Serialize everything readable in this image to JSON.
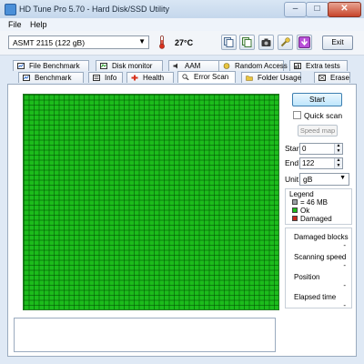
{
  "window": {
    "title": "HD Tune Pro 5.70 - Hard Disk/SSD Utility",
    "close": "✕",
    "minimize": "–",
    "maximize": "□"
  },
  "menu": {
    "file": "File",
    "help": "Help"
  },
  "toolbar": {
    "drive": "ASMT   2115 (122 gB)",
    "temperature": "27°C",
    "exit_label": "Exit"
  },
  "tabs_back": [
    {
      "label": "File Benchmark",
      "icon": "file-benchmark-icon"
    },
    {
      "label": "Disk monitor",
      "icon": "disk-monitor-icon"
    },
    {
      "label": "AAM",
      "icon": "speaker-icon"
    },
    {
      "label": "Random Access",
      "icon": "random-access-icon"
    },
    {
      "label": "Extra tests",
      "icon": "extra-tests-icon"
    }
  ],
  "tabs_front": [
    {
      "label": "Benchmark",
      "icon": "benchmark-icon"
    },
    {
      "label": "Info",
      "icon": "info-icon"
    },
    {
      "label": "Health",
      "icon": "health-cross-icon"
    },
    {
      "label": "Error Scan",
      "icon": "magnifier-icon",
      "active": true
    },
    {
      "label": "Folder Usage",
      "icon": "folder-icon"
    },
    {
      "label": "Erase",
      "icon": "erase-icon"
    }
  ],
  "controls": {
    "start_label": "Start",
    "quick_scan_label": "Quick scan",
    "quick_scan_checked": false,
    "speed_map_label": "Speed map",
    "start_field_label": "Start",
    "start_value": "0",
    "end_field_label": "End",
    "end_value": "122",
    "unit_label": "Unit",
    "unit_value": "gB"
  },
  "legend": {
    "title": "Legend",
    "items": [
      {
        "label": "= 46 MB",
        "color": "#9aa0a6"
      },
      {
        "label": "Ok",
        "color": "#1cbc1c"
      },
      {
        "label": "Damaged",
        "color": "#c8281e"
      }
    ]
  },
  "stats": {
    "damaged_blocks_label": "Damaged blocks",
    "damaged_blocks_value": "-",
    "scanning_speed_label": "Scanning speed",
    "scanning_speed_value": "-",
    "position_label": "Position",
    "position_value": "-",
    "elapsed_time_label": "Elapsed time",
    "elapsed_time_value": "-"
  },
  "colors": {
    "ok_block": "#1cbc1c",
    "damaged_block": "#c8281e",
    "accent": "#3c7fb1"
  }
}
